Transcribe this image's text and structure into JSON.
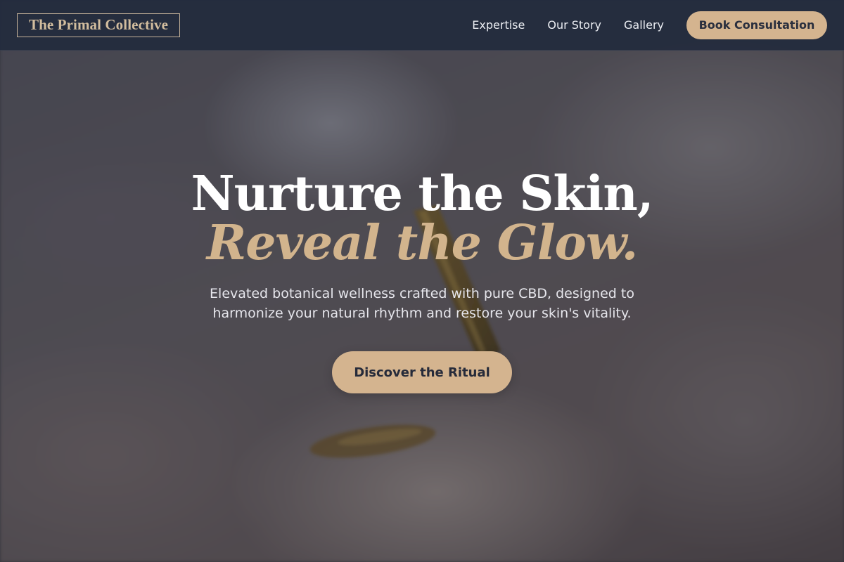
{
  "header": {
    "logo_text": "The Primal Collective",
    "nav_items": [
      {
        "label": "Expertise"
      },
      {
        "label": "Our Story"
      },
      {
        "label": "Gallery"
      }
    ],
    "cta_label": "Book Consultation"
  },
  "hero": {
    "headline_line1": "Nurture the Skin,",
    "headline_line2": "Reveal the Glow.",
    "subheadline": "Elevated botanical wellness crafted with pure CBD, designed to harmonize your natural rhythm and restore your skin's vitality.",
    "cta_label": "Discover the Ritual"
  },
  "colors": {
    "accent_gold": "#d4b48f",
    "header_navy": "#222b3d",
    "headline_white": "#ffffff"
  }
}
